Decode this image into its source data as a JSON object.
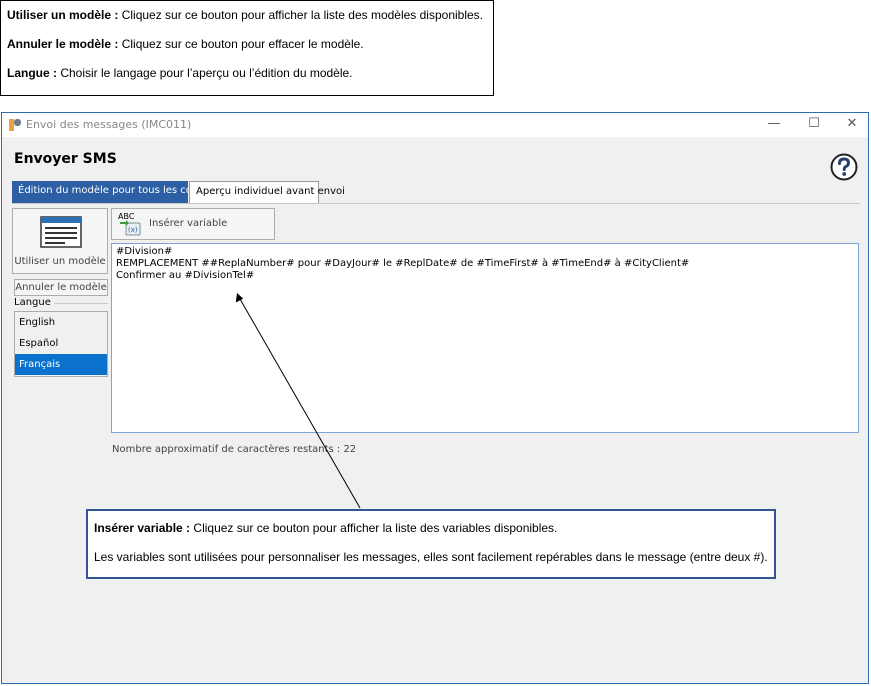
{
  "top_callout": {
    "use_template": {
      "term": "Utiliser un modèle :",
      "text": " Cliquez sur ce bouton pour afficher la liste des modèles disponibles."
    },
    "cancel_template": {
      "term": "Annuler le modèle :",
      "text": " Cliquez sur ce bouton pour effacer le modèle."
    },
    "language": {
      "term": "Langue :",
      "text": " Choisir le langage pour l’aperçu ou l’édition du modèle."
    }
  },
  "window": {
    "title": "Envoi des messages (IMC011)",
    "minimize_glyph": "—",
    "maximize_glyph": "☐",
    "close_glyph": "✕",
    "accent_color": "#2d5fa5"
  },
  "page": {
    "title": "Envoyer SMS",
    "help_icon": "help-question-icon"
  },
  "tabs": [
    {
      "label": "Édition du modèle pour tous les contacts",
      "active": true
    },
    {
      "label": "Aperçu individuel avant envoi",
      "active": false
    }
  ],
  "left_panel": {
    "use_template_label": "Utiliser un modèle",
    "cancel_template_label": "Annuler le modèle",
    "language_group_label": "Langue",
    "languages": [
      {
        "label": "English",
        "selected": false
      },
      {
        "label": "Español",
        "selected": false
      },
      {
        "label": "Français",
        "selected": true
      }
    ]
  },
  "toolbar": {
    "insert_variable_label": "Insérer variable",
    "insert_icon_text": "ABC",
    "insert_icon_code": "(x)"
  },
  "editor": {
    "content": "#Division#\nREMPLACEMENT ##ReplaNumber# pour #DayJour# le #ReplDate# de #TimeFirst# à #TimeEnd# à #CityClient#\nConfirmer au #DivisionTel#"
  },
  "counter": {
    "text": "Nombre approximatif de caractères restants : 22"
  },
  "bottom_callout": {
    "insert_variable": {
      "term": "Insérer variable :",
      "text": " Cliquez sur ce bouton pour afficher la liste des variables disponibles."
    },
    "variables_note": "Les variables sont utilisées pour personnaliser les messages, elles sont facilement repérables dans le message (entre deux #)."
  }
}
